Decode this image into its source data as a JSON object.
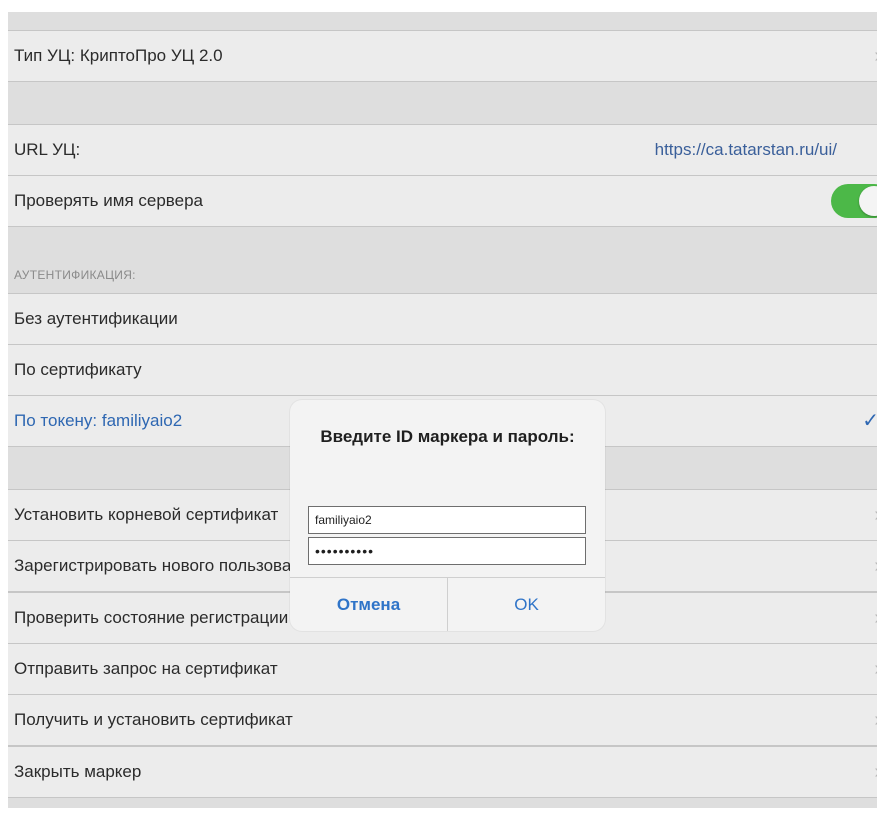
{
  "settings": {
    "ca_type": {
      "label": "Тип УЦ: КриптоПро УЦ 2.0"
    },
    "ca_url": {
      "label": "URL УЦ:",
      "value": "https://ca.tatarstan.ru/ui/"
    },
    "verify_server": {
      "label": "Проверять имя сервера",
      "enabled": true
    }
  },
  "auth": {
    "header": "АУТЕНТИФИКАЦИЯ:",
    "none": "Без аутентификации",
    "certificate": "По сертификату",
    "token": "По токену: familiyaio2"
  },
  "actions": {
    "install_root": "Установить корневой сертификат",
    "register_user": "Зарегистрировать нового пользователя",
    "check_status": "Проверить состояние регистрации",
    "send_request": "Отправить запрос на сертификат",
    "get_install": "Получить и установить сертификат",
    "close_token": "Закрыть маркер"
  },
  "dialog": {
    "title": "Введите ID маркера и пароль:",
    "token_id_value": "familiyaio2",
    "password_value": "••••••••••",
    "cancel_label": "Отмена",
    "ok_label": "OK"
  },
  "icons": {
    "chevron": "›",
    "checkmark": "✓"
  },
  "colors": {
    "accent_blue": "#2f74c8",
    "toggle_on": "#4cb848"
  }
}
